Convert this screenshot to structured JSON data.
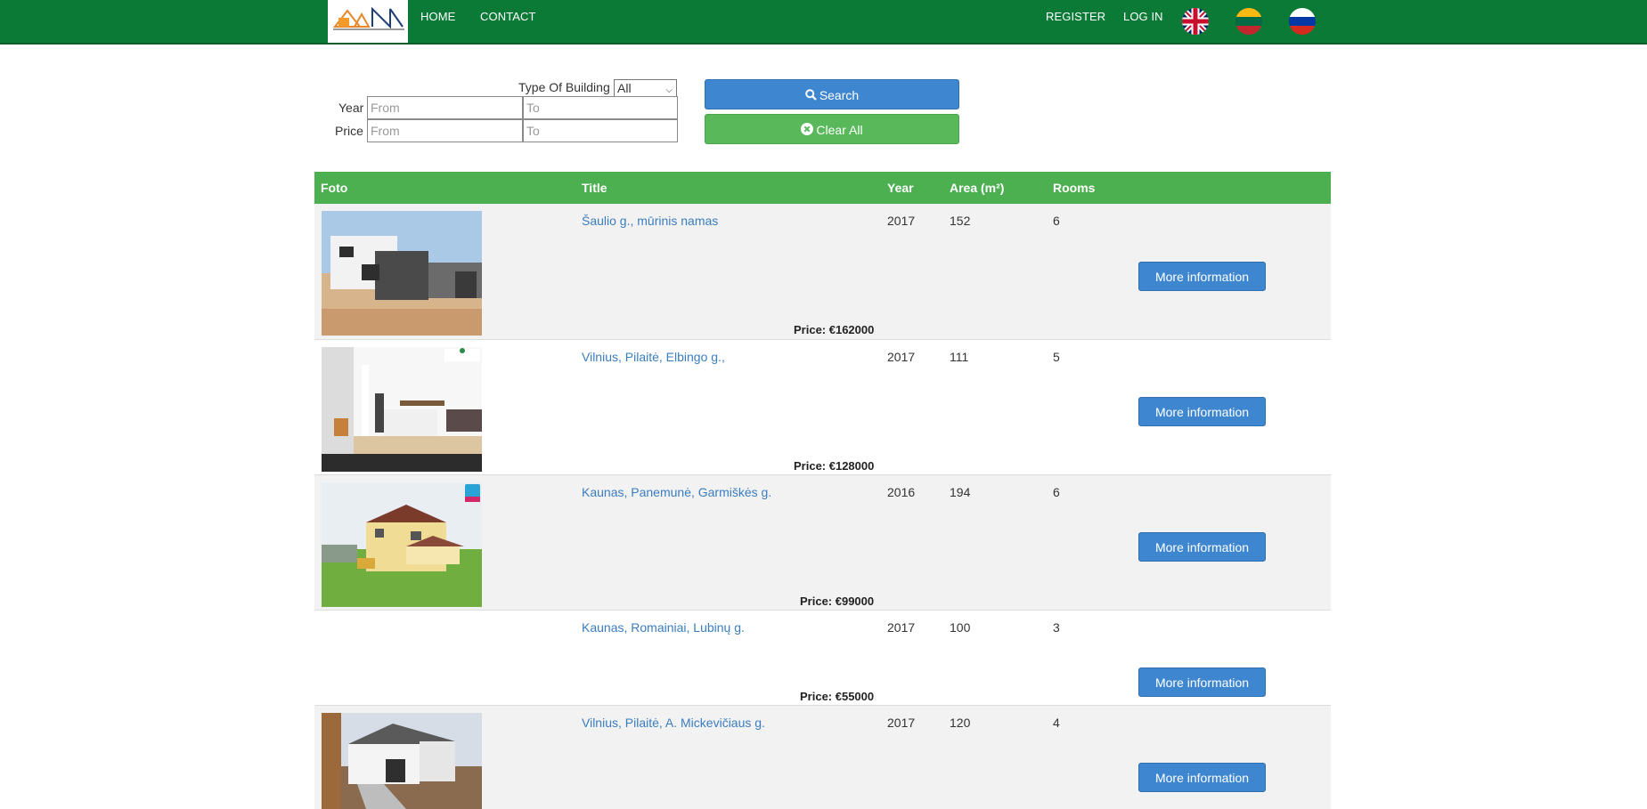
{
  "nav": {
    "home": "HOME",
    "contact": "CONTACT",
    "register": "REGISTER",
    "login": "LOG IN",
    "languages": [
      "en-flag",
      "lt-flag",
      "ru-flag"
    ]
  },
  "search": {
    "type_label": "Type Of Building",
    "type_value": "All",
    "year_label": "Year",
    "price_label": "Price",
    "from_placeholder": "From",
    "to_placeholder": "To",
    "search_button": "Search",
    "clear_button": "Clear All"
  },
  "table": {
    "headers": [
      "Foto",
      "Title",
      "Year",
      "Area (m²)",
      "Rooms"
    ],
    "more_label": "More information",
    "rows": [
      {
        "title": "Šaulio g., mūrinis namas",
        "year": "2017",
        "area": "152",
        "rooms": "6",
        "price": "Price: €162000"
      },
      {
        "title": "Vilnius, Pilaitė, Elbingo g.,",
        "year": "2017",
        "area": "111",
        "rooms": "5",
        "price": "Price: €128000"
      },
      {
        "title": "Kaunas, Panemunė, Garmiškės g.",
        "year": "2016",
        "area": "194",
        "rooms": "6",
        "price": "Price: €99000"
      },
      {
        "title": "Kaunas, Romainiai, Lubinų g.",
        "year": "2017",
        "area": "100",
        "rooms": "3",
        "price": "Price: €55000"
      },
      {
        "title": "Vilnius, Pilaitė, A. Mickevičiaus g.",
        "year": "2017",
        "area": "120",
        "rooms": "4",
        "price": ""
      }
    ]
  },
  "colors": {
    "navbar": "#0b7a37",
    "table_header": "#4caf50",
    "primary_button": "#3e86d0",
    "clear_button": "#58b85a",
    "link": "#3a7dc0"
  }
}
